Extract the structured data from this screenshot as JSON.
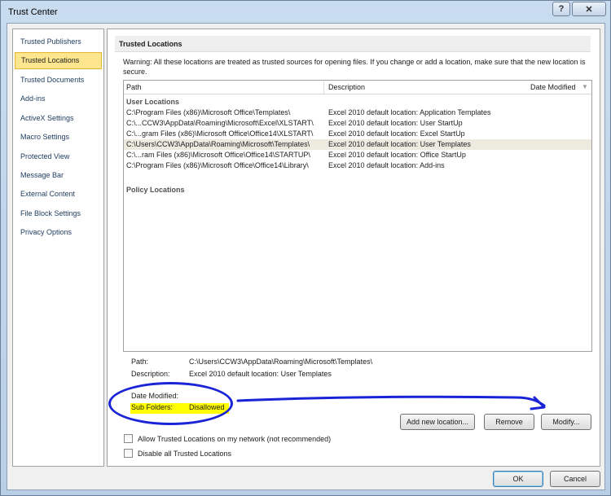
{
  "window": {
    "title": "Trust Center",
    "help_glyph": "?",
    "close_glyph": "✕"
  },
  "nav": {
    "items": [
      {
        "label": "Trusted Publishers"
      },
      {
        "label": "Trusted Locations"
      },
      {
        "label": "Trusted Documents"
      },
      {
        "label": "Add-ins"
      },
      {
        "label": "ActiveX Settings"
      },
      {
        "label": "Macro Settings"
      },
      {
        "label": "Protected View"
      },
      {
        "label": "Message Bar"
      },
      {
        "label": "External Content"
      },
      {
        "label": "File Block Settings"
      },
      {
        "label": "Privacy Options"
      }
    ],
    "active": "Trusted Locations"
  },
  "pane": {
    "header": "Trusted Locations",
    "warning": "Warning: All these locations are treated as trusted sources for opening files.  If you change or add a location, make sure that the new location is secure."
  },
  "list": {
    "columns": {
      "path": "Path",
      "description": "Description",
      "date_modified": "Date Modified"
    },
    "user_section": "User Locations",
    "policy_section": "Policy Locations",
    "rows": [
      {
        "path": "C:\\Program Files (x86)\\Microsoft Office\\Templates\\",
        "description": "Excel 2010 default location: Application Templates"
      },
      {
        "path": "C:\\...CCW3\\AppData\\Roaming\\Microsoft\\Excel\\XLSTART\\",
        "description": "Excel 2010 default location: User StartUp"
      },
      {
        "path": "C:\\...gram Files (x86)\\Microsoft Office\\Office14\\XLSTART\\",
        "description": "Excel 2010 default location: Excel StartUp"
      },
      {
        "path": "C:\\Users\\CCW3\\AppData\\Roaming\\Microsoft\\Templates\\",
        "description": "Excel 2010 default location: User Templates"
      },
      {
        "path": "C:\\...ram Files (x86)\\Microsoft Office\\Office14\\STARTUP\\",
        "description": "Excel 2010 default location: Office StartUp"
      },
      {
        "path": "C:\\Program Files (x86)\\Microsoft Office\\Office14\\Library\\",
        "description": "Excel 2010 default location: Add-ins"
      }
    ],
    "selected_index": 3
  },
  "details": {
    "path_label": "Path:",
    "path_value": "C:\\Users\\CCW3\\AppData\\Roaming\\Microsoft\\Templates\\",
    "description_label": "Description:",
    "description_value": "Excel 2010 default location: User Templates",
    "date_modified_label": "Date Modified:",
    "subfolders_label": "Sub Folders:",
    "subfolders_value": "Disallowed"
  },
  "buttons": {
    "add_new": "Add new location...",
    "remove": "Remove",
    "modify": "Modify...",
    "ok": "OK",
    "cancel": "Cancel"
  },
  "options": {
    "allow_network": "Allow Trusted Locations on my network (not recommended)",
    "allow_network_checked": false,
    "disable_all": "Disable all Trusted Locations",
    "disable_all_checked": false
  },
  "colors": {
    "annotation": "#1a24d6",
    "highlight": "#ffff00",
    "active_nav": "#fde68e"
  }
}
